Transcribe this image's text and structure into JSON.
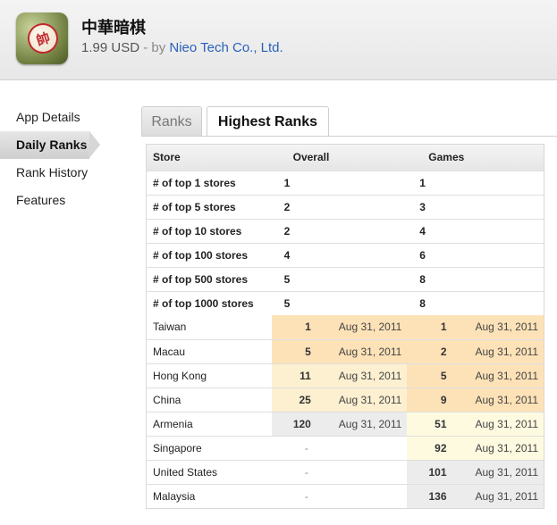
{
  "app": {
    "icon_glyph": "帥",
    "title": "中華暗棋",
    "price": "1.99 USD",
    "by_label": " - by ",
    "developer": "Nieo Tech Co., Ltd."
  },
  "sidebar": {
    "items": [
      {
        "label": "App Details",
        "active": false
      },
      {
        "label": "Daily Ranks",
        "active": true
      },
      {
        "label": "Rank History",
        "active": false
      },
      {
        "label": "Features",
        "active": false
      }
    ]
  },
  "tabs": {
    "ranks": "Ranks",
    "highest_ranks": "Highest Ranks"
  },
  "table": {
    "headers": {
      "store": "Store",
      "overall": "Overall",
      "games": "Games"
    },
    "summary": [
      {
        "label": "# of top 1 stores",
        "overall": "1",
        "games": "1"
      },
      {
        "label": "# of top 5 stores",
        "overall": "2",
        "games": "3"
      },
      {
        "label": "# of top 10 stores",
        "overall": "2",
        "games": "4"
      },
      {
        "label": "# of top 100 stores",
        "overall": "4",
        "games": "6"
      },
      {
        "label": "# of top 500 stores",
        "overall": "5",
        "games": "8"
      },
      {
        "label": "# of top 1000 stores",
        "overall": "5",
        "games": "8"
      }
    ],
    "countries": [
      {
        "store": "Taiwan",
        "overall_rank": "1",
        "overall_date": "Aug 31, 2011",
        "games_rank": "1",
        "games_date": "Aug 31, 2011",
        "overall_color": "#fde2b8",
        "games_color": "#fde2b8"
      },
      {
        "store": "Macau",
        "overall_rank": "5",
        "overall_date": "Aug 31, 2011",
        "games_rank": "2",
        "games_date": "Aug 31, 2011",
        "overall_color": "#fde2b8",
        "games_color": "#fde2b8"
      },
      {
        "store": "Hong Kong",
        "overall_rank": "11",
        "overall_date": "Aug 31, 2011",
        "games_rank": "5",
        "games_date": "Aug 31, 2011",
        "overall_color": "#fdf0d0",
        "games_color": "#fde2b8"
      },
      {
        "store": "China",
        "overall_rank": "25",
        "overall_date": "Aug 31, 2011",
        "games_rank": "9",
        "games_date": "Aug 31, 2011",
        "overall_color": "#fdf0d0",
        "games_color": "#fde2b8"
      },
      {
        "store": "Armenia",
        "overall_rank": "120",
        "overall_date": "Aug 31, 2011",
        "games_rank": "51",
        "games_date": "Aug 31, 2011",
        "overall_color": "#ececec",
        "games_color": "#fefae0"
      },
      {
        "store": "Singapore",
        "overall_rank": "-",
        "overall_date": "",
        "games_rank": "92",
        "games_date": "Aug 31, 2011",
        "overall_color": "#ffffff",
        "games_color": "#fefae0"
      },
      {
        "store": "United States",
        "overall_rank": "-",
        "overall_date": "",
        "games_rank": "101",
        "games_date": "Aug 31, 2011",
        "overall_color": "#ffffff",
        "games_color": "#ececec"
      },
      {
        "store": "Malaysia",
        "overall_rank": "-",
        "overall_date": "",
        "games_rank": "136",
        "games_date": "Aug 31, 2011",
        "overall_color": "#ffffff",
        "games_color": "#ececec"
      }
    ]
  }
}
